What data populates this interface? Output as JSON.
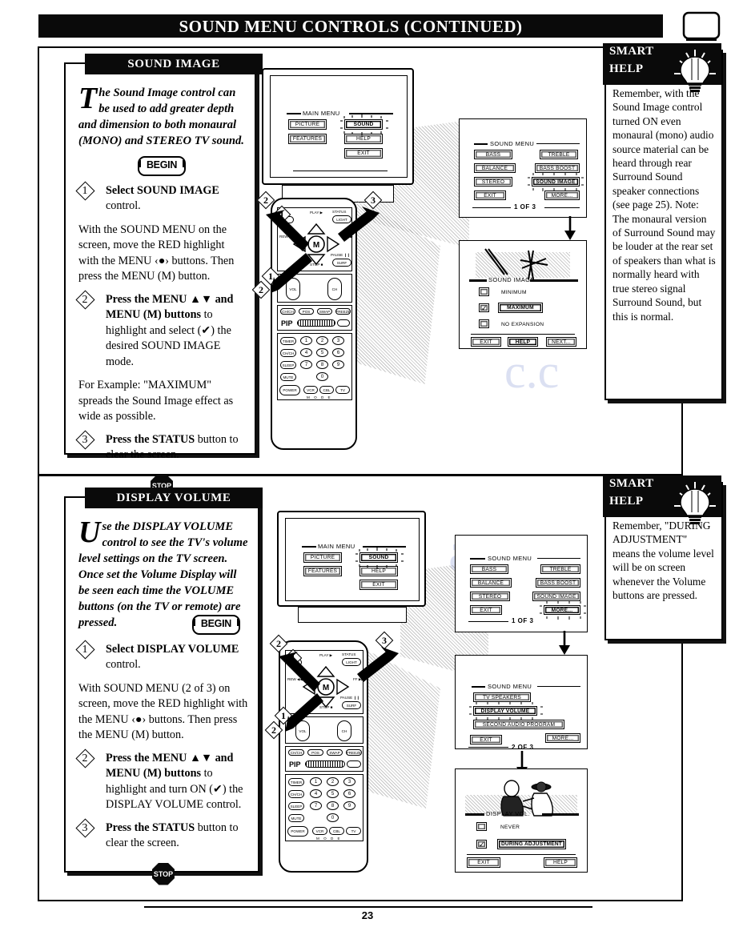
{
  "page": {
    "banner_title": "SOUND MENU CONTROLS (CONTINUED)",
    "page_number": "23"
  },
  "sections": [
    {
      "id": "sound-image",
      "header": "SOUND IMAGE",
      "intro_dropcap": "T",
      "intro_text": "he Sound Image control can be used to add greater depth and dimension to both monaural (MONO) and STEREO TV sound.",
      "begin_label": "BEGIN",
      "steps": [
        {
          "num": "1",
          "bold": "Select SOUND IMAGE",
          "rest": " control."
        },
        {
          "num": "2",
          "bold": "Press the MENU ▲▼ and MENU (M) buttons",
          "rest": " to highlight and select (✔) the desired SOUND IMAGE mode."
        },
        {
          "num": "3",
          "bold": "Press the STATUS",
          "rest": " button to clear the screen."
        }
      ],
      "para_after_step1": "With the SOUND MENU on the screen, move the RED highlight with the MENU ‹●› buttons. Then press the MENU (M) button.",
      "para_after_step2": "For Example: \"MAXIMUM\" spreads the Sound Image effect as wide as possible.",
      "stop_label": "STOP",
      "smart_help": {
        "title_line1": "SMART",
        "title_line2": "HELP",
        "body": "Remember, with the Sound Image control turned ON even monaural (mono) audio source material can be heard through rear Surround Sound speaker connections (see page 25). Note: The monaural version of Surround Sound may be louder at the rear set of speakers than what is normally heard with true stereo signal Surround Sound, but this is normal."
      },
      "tv_screen": {
        "menu_title": "MAIN MENU",
        "buttons": [
          {
            "label": "PICTURE",
            "highlighted": false
          },
          {
            "label": "SOUND",
            "highlighted": true
          },
          {
            "label": "FEATURES",
            "highlighted": false
          },
          {
            "label": "HELP",
            "highlighted": false
          },
          {
            "label": "EXIT",
            "highlighted": false
          }
        ]
      },
      "osd_menu": {
        "title": "SOUND MENU",
        "page_indicator": "1 OF 3",
        "buttons": [
          {
            "label": "BASS",
            "highlighted": false
          },
          {
            "label": "TREBLE",
            "highlighted": false
          },
          {
            "label": "BALANCE",
            "highlighted": false
          },
          {
            "label": "BASS BOOST",
            "highlighted": false
          },
          {
            "label": "STEREO",
            "highlighted": false
          },
          {
            "label": "SOUND IMAGE",
            "highlighted": true
          },
          {
            "label": "EXIT",
            "highlighted": false
          },
          {
            "label": "MORE...",
            "highlighted": false
          }
        ]
      },
      "osd_submenu": {
        "title": "SOUND IMAGE",
        "options": [
          {
            "label": "MINIMUM",
            "checked": false,
            "highlighted": false
          },
          {
            "label": "MAXIMUM",
            "checked": true,
            "highlighted": true
          },
          {
            "label": "NO EXPANSION",
            "checked": false,
            "highlighted": false
          }
        ],
        "buttons": [
          {
            "label": "EXIT",
            "highlighted": false
          },
          {
            "label": "HELP",
            "highlighted": true
          },
          {
            "label": "NEXT...",
            "highlighted": false
          }
        ]
      }
    },
    {
      "id": "display-volume",
      "header": "DISPLAY VOLUME",
      "intro_dropcap": "U",
      "intro_text": "se the DISPLAY VOLUME control to see the TV's volume level settings on the TV screen. Once set  the Volume Display will be seen each time the VOLUME buttons (on the TV or remote) are pressed.",
      "begin_label": "BEGIN",
      "steps": [
        {
          "num": "1",
          "bold": "Select DISPLAY VOLUME",
          "rest": " control."
        },
        {
          "num": "2",
          "bold": "Press the MENU ▲▼ and MENU (M) buttons",
          "rest": " to highlight and turn ON (✔) the DISPLAY VOLUME control."
        },
        {
          "num": "3",
          "bold": "Press the STATUS",
          "rest": " button to clear the screen."
        }
      ],
      "para_after_step1": "With SOUND MENU (2 of 3) on screen, move the RED highlight with the MENU ‹●› buttons. Then press the MENU (M) button.",
      "stop_label": "STOP",
      "smart_help": {
        "title_line1": "SMART",
        "title_line2": "HELP",
        "body": "Remember, \"DURING ADJUSTMENT\" means the volume level will be on screen whenever the Volume buttons are pressed."
      },
      "tv_screen": {
        "menu_title": "MAIN MENU",
        "buttons": [
          {
            "label": "PICTURE",
            "highlighted": false
          },
          {
            "label": "SOUND",
            "highlighted": true
          },
          {
            "label": "FEATURES",
            "highlighted": false
          },
          {
            "label": "HELP",
            "highlighted": false
          },
          {
            "label": "EXIT",
            "highlighted": false
          }
        ]
      },
      "osd_menu": {
        "title": "SOUND MENU",
        "page_indicator": "1 OF 3",
        "buttons": [
          {
            "label": "BASS",
            "highlighted": false
          },
          {
            "label": "TREBLE",
            "highlighted": false
          },
          {
            "label": "BALANCE",
            "highlighted": false
          },
          {
            "label": "BASS BOOST",
            "highlighted": false
          },
          {
            "label": "STEREO",
            "highlighted": false
          },
          {
            "label": "SOUND IMAGE",
            "highlighted": false
          },
          {
            "label": "EXIT",
            "highlighted": false
          },
          {
            "label": "MORE...",
            "highlighted": true
          }
        ]
      },
      "osd_menu2": {
        "title": "SOUND MENU",
        "page_indicator": "2 OF 3",
        "buttons": [
          {
            "label": "TV SPEAKERS",
            "highlighted": false
          },
          {
            "label": "DISPLAY VOLUME",
            "highlighted": true
          },
          {
            "label": "SECOND AUDIO PROGRAM",
            "highlighted": false
          },
          {
            "label": "EXIT",
            "highlighted": false
          },
          {
            "label": "MORE...",
            "highlighted": false
          }
        ]
      },
      "osd_submenu": {
        "title": "DISPLAY VOL.",
        "options": [
          {
            "label": "NEVER",
            "checked": false,
            "highlighted": false
          },
          {
            "label": "DURING ADJUSTMENT",
            "checked": true,
            "highlighted": true
          }
        ],
        "buttons": [
          {
            "label": "EXIT",
            "highlighted": false
          },
          {
            "label": "HELP",
            "highlighted": false
          }
        ]
      }
    }
  ],
  "remote": {
    "dpad_center": "M",
    "labels": {
      "play": "PLAY ▶",
      "stop": "STOP ■",
      "rew": "REW ◀◀",
      "ff": "FF ▶▶",
      "status": "STATUS",
      "light": "LIGHT",
      "pause": "PAUSE ❙❙",
      "surf": "SURF",
      "vol": "VOL",
      "ch": "CH",
      "pip": "PIP",
      "mode": "M O D E"
    },
    "side_keys": [
      "TIMER",
      "CH/CH",
      "SLEEP",
      "MUTE"
    ],
    "fn_keys": [
      "CH/CH",
      "POS",
      "SWAP",
      "FREEZE"
    ],
    "mode_keys": [
      "VCR",
      "CBL",
      "TV"
    ],
    "power_key": "POWER",
    "numbers": [
      "1",
      "2",
      "3",
      "4",
      "5",
      "6",
      "7",
      "8",
      "9",
      "0"
    ]
  },
  "callouts": [
    "1",
    "2",
    "3"
  ],
  "colors": {
    "ink": "#000000",
    "paper": "#ffffff",
    "banner": "#0a0a0a",
    "watermark": "#b9c3e6"
  }
}
